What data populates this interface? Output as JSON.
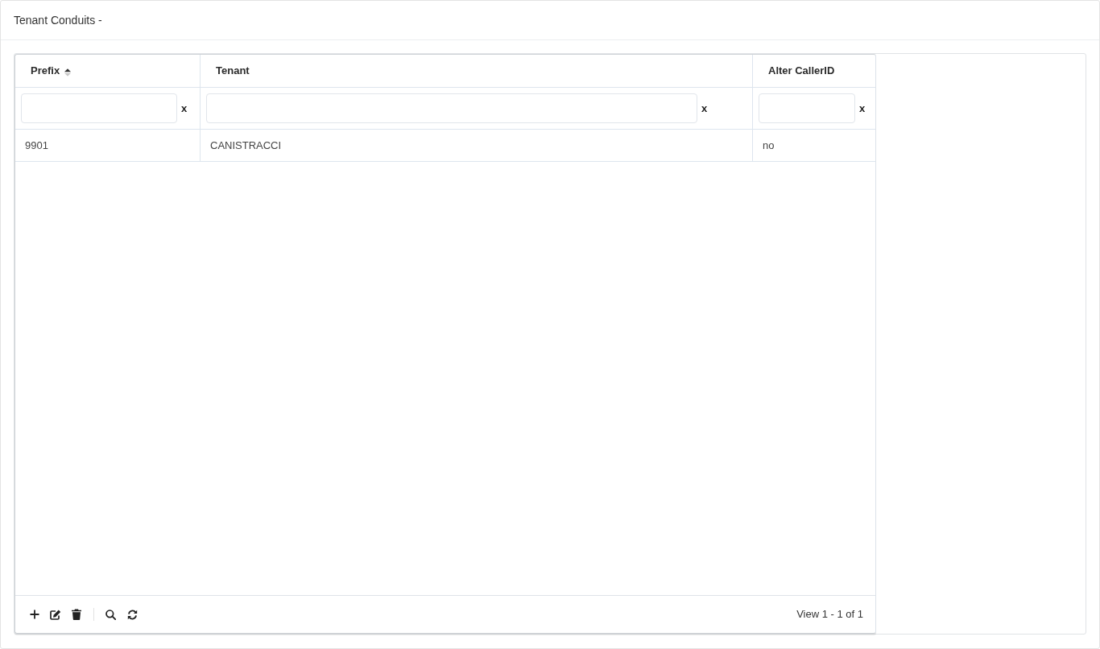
{
  "page": {
    "title": "Tenant Conduits -"
  },
  "grid": {
    "columns": [
      {
        "label": "Prefix",
        "sorted": true,
        "filter_clear": "x"
      },
      {
        "label": "Tenant",
        "sorted": false,
        "filter_clear": "x"
      },
      {
        "label": "Alter CallerID",
        "sorted": false,
        "filter_clear": "x"
      }
    ],
    "rows": [
      {
        "cells": [
          "9901",
          "CANISTRACCI",
          "no"
        ]
      }
    ],
    "pager": {
      "info": "View 1 - 1 of 1"
    }
  }
}
